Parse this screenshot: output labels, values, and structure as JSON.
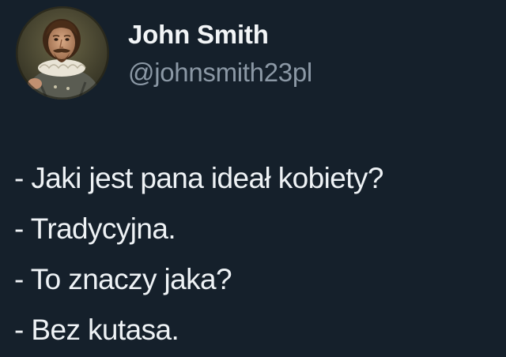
{
  "tweet": {
    "author": {
      "name": "John Smith",
      "handle": "@johnsmith23pl",
      "avatar": {
        "icon": "profile-portrait-avatar",
        "description_colors": {
          "background": "#3b3a2a",
          "ruff_collar": "#e9e4d6",
          "armor": "#5a5c52",
          "hair_beard": "#4a2d18"
        }
      }
    },
    "lines": [
      "- Jaki jest pana ideał kobiety?",
      "- Tradycyjna.",
      "- To znaczy jaka?",
      "- Bez kutasa."
    ]
  },
  "theme": {
    "background": "#15202b",
    "text": "#eef2f5",
    "secondary_text": "#8b98a5"
  }
}
